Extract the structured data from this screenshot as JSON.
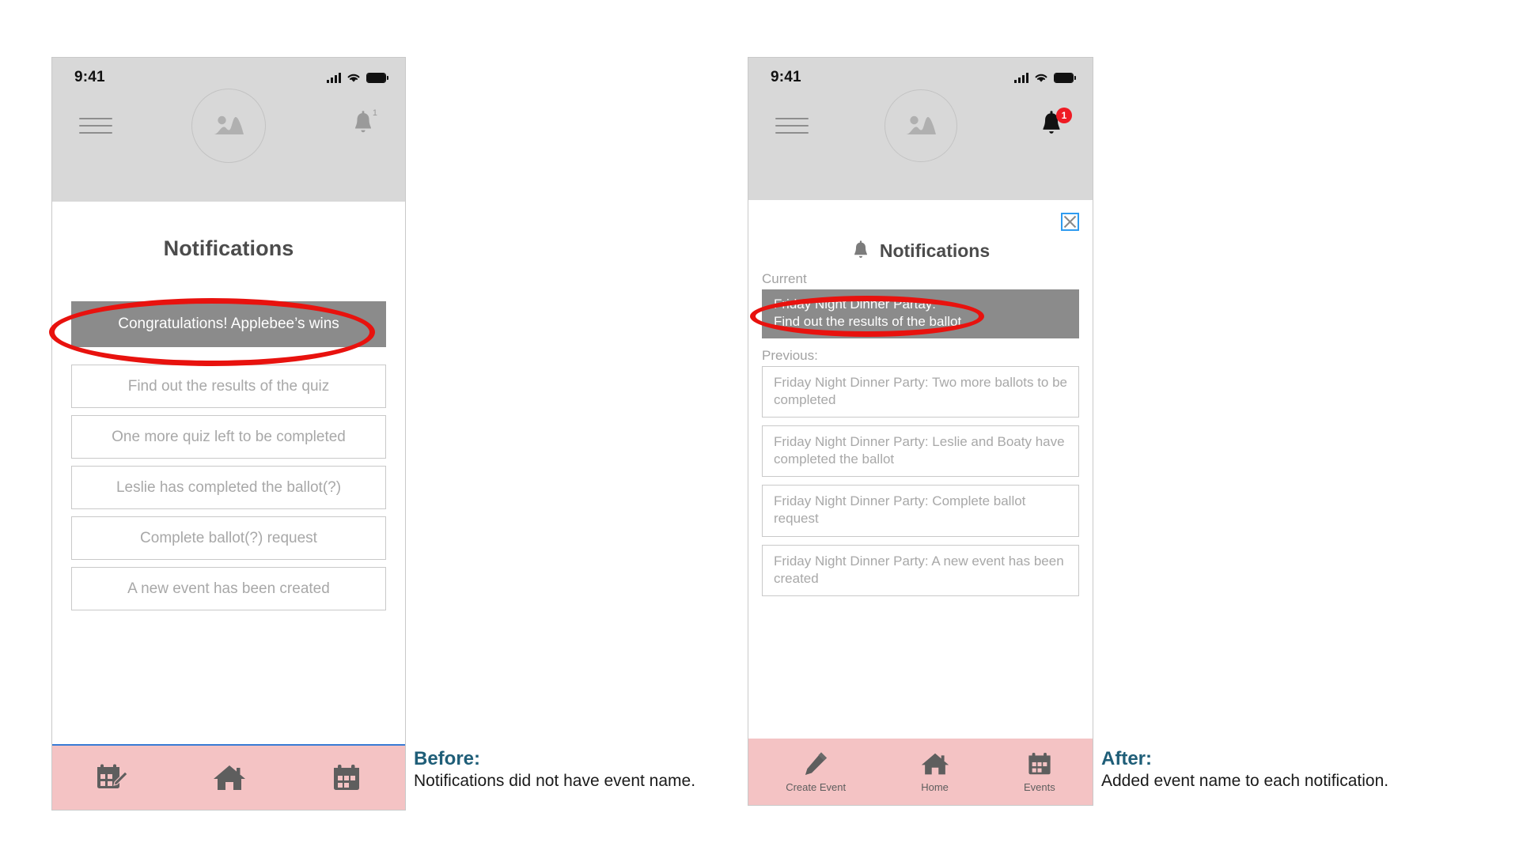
{
  "phone_before": {
    "status": {
      "time": "9:41",
      "signal_icon": "signal-bars-icon",
      "wifi_icon": "wifi-icon",
      "battery_icon": "battery-icon"
    },
    "header": {
      "menu_icon": "hamburger-menu-icon",
      "avatar_icon": "image-placeholder-icon",
      "bell_icon": "bell-icon"
    },
    "screen_title": "Notifications",
    "notifications": [
      {
        "text": "Congratulations! Applebee’s wins",
        "highlighted": true
      },
      {
        "text": "Find out the results of the quiz",
        "highlighted": false
      },
      {
        "text": "One more quiz left to be completed",
        "highlighted": false
      },
      {
        "text": "Leslie has completed the ballot(?)",
        "highlighted": false
      },
      {
        "text": "Complete ballot(?) request",
        "highlighted": false
      },
      {
        "text": "A new event has been created",
        "highlighted": false
      }
    ],
    "bottom_nav": [
      {
        "label": "",
        "icon": "create-event-calendar-pencil-icon"
      },
      {
        "label": "",
        "icon": "home-icon"
      },
      {
        "label": "",
        "icon": "events-calendar-icon"
      }
    ]
  },
  "phone_after": {
    "status": {
      "time": "9:41",
      "signal_icon": "signal-bars-icon",
      "wifi_icon": "wifi-icon",
      "battery_icon": "battery-icon"
    },
    "header": {
      "menu_icon": "hamburger-menu-icon",
      "avatar_icon": "image-placeholder-icon",
      "bell_icon": "bell-icon",
      "bell_badge_count": "1"
    },
    "close_icon": "close-x-icon",
    "panel_title": "Notifications",
    "panel_title_icon": "bell-icon",
    "current_label": "Current",
    "current_notification": {
      "event_name": "Friday Night Dinner Partay:",
      "message": "Find out the results of the ballot"
    },
    "previous_label": "Previous:",
    "previous_notifications": [
      "Friday Night Dinner Party: Two more ballots to be completed",
      "Friday Night Dinner Party: Leslie and Boaty have completed the ballot",
      "Friday Night Dinner Party: Complete ballot request",
      "Friday Night Dinner Party: A new event has been created"
    ],
    "bottom_nav": [
      {
        "label": "Create Event",
        "icon": "pencil-icon"
      },
      {
        "label": "Home",
        "icon": "home-icon"
      },
      {
        "label": "Events",
        "icon": "calendar-icon"
      }
    ]
  },
  "annotations": {
    "before": {
      "heading": "Before:",
      "text": "Notifications did not have event name."
    },
    "after": {
      "heading": "After:",
      "text": "Added event name to each notification."
    }
  },
  "colors": {
    "header_gray": "#d8d8d8",
    "nav_pink": "#f4c3c4",
    "highlight_gray": "#8b8b8b",
    "annotation_red": "#e8120e",
    "caption_blue": "#1f5e78",
    "badge_red": "#ef1b24",
    "close_blue": "#2e9bf0"
  }
}
